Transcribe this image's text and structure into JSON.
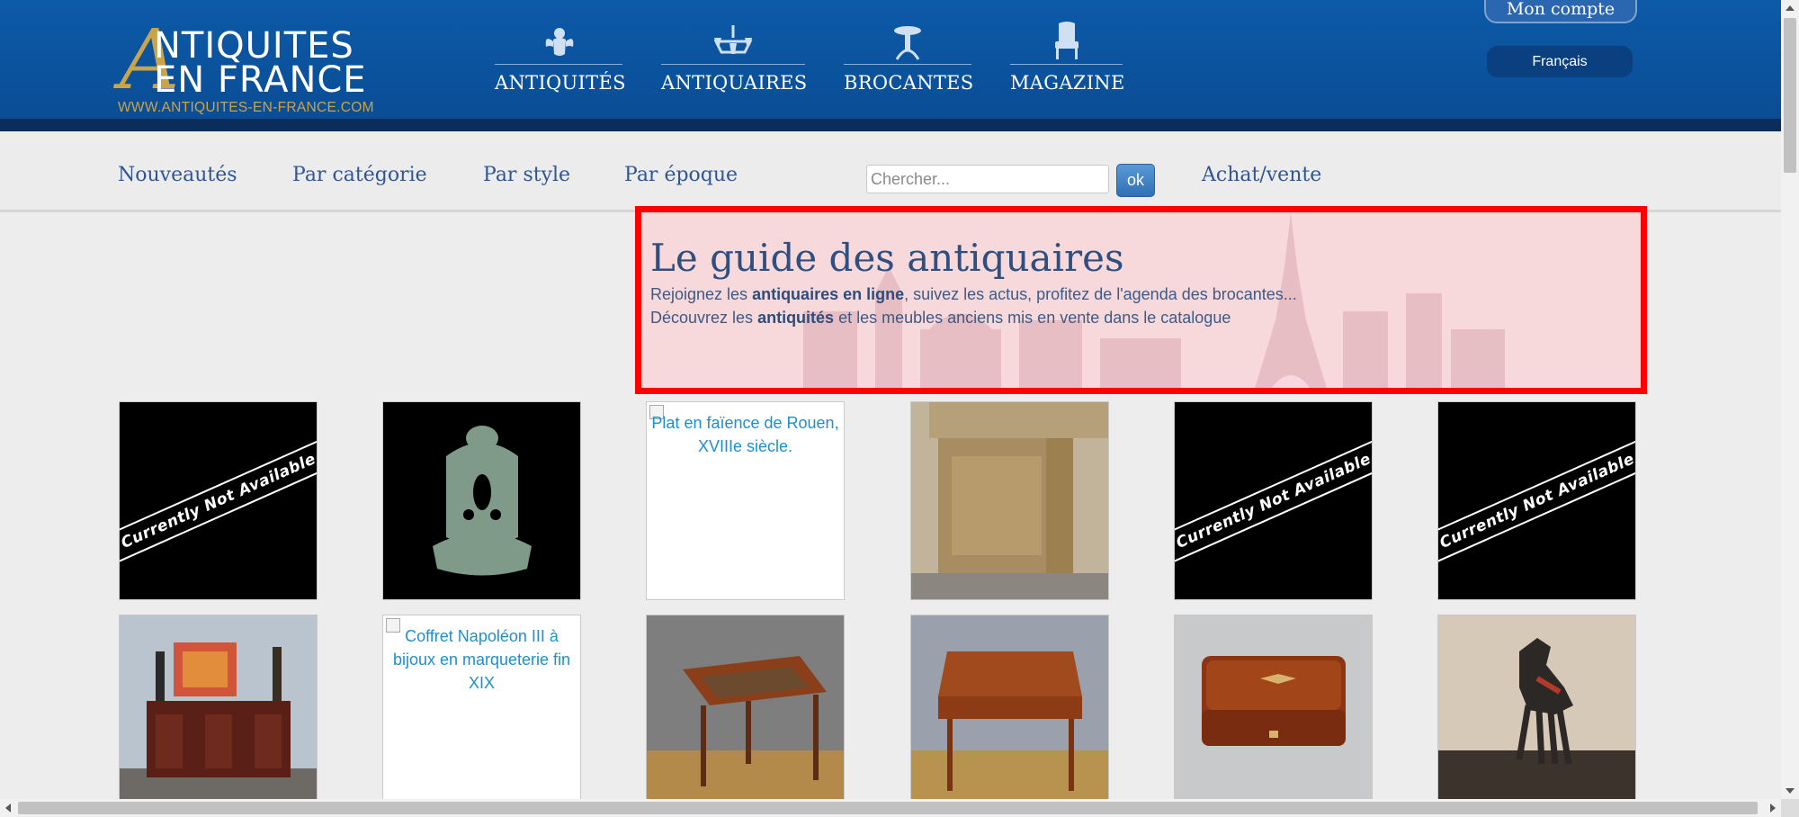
{
  "colors": {
    "header_blue": "#0d5aa8",
    "nav_link": "#2f5597",
    "gold": "#c9a44a",
    "hero_border": "#ff0000"
  },
  "logo": {
    "line1": "NTIQUITES",
    "letter": "A",
    "line2": "EN FRANCE",
    "url": "WWW.ANTIQUITES-EN-FRANCE.COM"
  },
  "main_nav": [
    {
      "label": "ANTIQUITÉS",
      "icon": "cherub-icon"
    },
    {
      "label": "ANTIQUAIRES",
      "icon": "chandelier-icon"
    },
    {
      "label": "BROCANTES",
      "icon": "pedestal-table-icon"
    },
    {
      "label": "MAGAZINE",
      "icon": "armchair-icon"
    }
  ],
  "account": {
    "label": "Mon compte",
    "language": "Français"
  },
  "sub_nav": {
    "items": [
      "Nouveautés",
      "Par catégorie",
      "Par style",
      "Par époque"
    ],
    "sell": "Achat/vente"
  },
  "search": {
    "placeholder": "Chercher...",
    "button": "ok"
  },
  "hero": {
    "title": "Le guide des antiquaires",
    "line1_a": "Rejoignez les ",
    "line1_b": "antiquaires en ligne",
    "line1_c": ", suivez les actus, profitez de l'agenda des brocantes...",
    "line2_a": "Découvrez les ",
    "line2_b": "antiquités",
    "line2_c": " et les meubles anciens mis en vente dans le catalogue"
  },
  "products_row1": [
    {
      "type": "na",
      "text": "Currently Not Available"
    },
    {
      "type": "image",
      "subject": "ornate cast iron fountain"
    },
    {
      "type": "alt",
      "text": "Plat en faïence de Rouen, XVIIIe siècle."
    },
    {
      "type": "image",
      "subject": "carved oak sideboard"
    },
    {
      "type": "na",
      "text": "Currently Not Available"
    },
    {
      "type": "na",
      "text": "Currently Not Available"
    }
  ],
  "products_row2": [
    {
      "type": "image",
      "subject": "mahogany buffet"
    },
    {
      "type": "alt",
      "text": "Coffret Napoléon III à bijoux en marqueterie fin XIX"
    },
    {
      "type": "image",
      "subject": "games table"
    },
    {
      "type": "image",
      "subject": "marquetry writing desk"
    },
    {
      "type": "image",
      "subject": "jewelry box"
    },
    {
      "type": "image",
      "subject": "carousel horse statue"
    }
  ]
}
